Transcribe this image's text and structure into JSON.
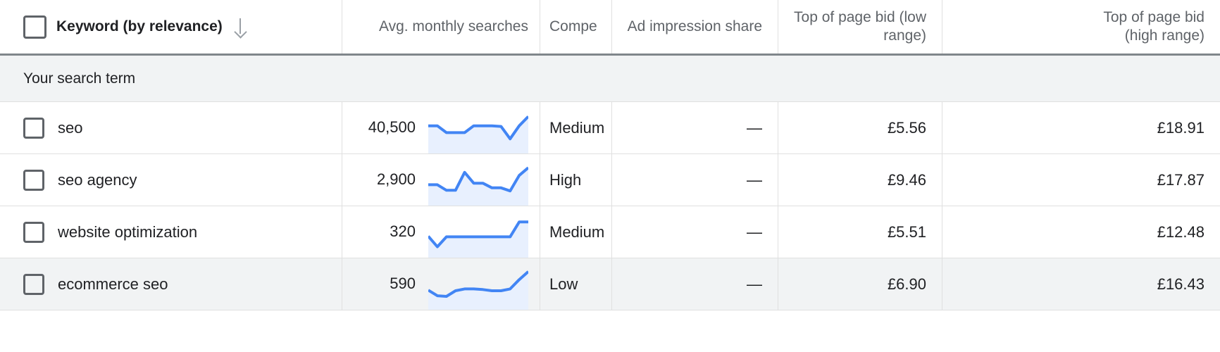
{
  "table": {
    "columns": [
      {
        "id": "keyword",
        "label": "Keyword (by relevance)",
        "sort_icon": "arrow-down-icon"
      },
      {
        "id": "searches",
        "label": "Avg. monthly searches"
      },
      {
        "id": "competition",
        "label": "Compe",
        "full_label": "Competition",
        "truncated": true
      },
      {
        "id": "impression_share",
        "label": "Ad impression share"
      },
      {
        "id": "bid_low",
        "label_line1": "Top of page bid (low",
        "label_line2": "range)"
      },
      {
        "id": "bid_high",
        "label_line1": "Top of page bid",
        "label_line2": "(high range)"
      }
    ],
    "group_label": "Your search term",
    "rows": [
      {
        "keyword": "seo",
        "avg_monthly_searches": "40,500",
        "competition": "Medium",
        "ad_impression_share": "—",
        "bid_low": "£5.56",
        "bid_high": "£18.91",
        "highlighted": false,
        "sparkline": [
          62,
          62,
          40,
          40,
          40,
          62,
          62,
          62,
          60,
          20,
          62,
          92
        ]
      },
      {
        "keyword": "seo agency",
        "avg_monthly_searches": "2,900",
        "competition": "High",
        "ad_impression_share": "—",
        "bid_low": "£9.46",
        "bid_high": "£17.87",
        "highlighted": false,
        "sparkline": [
          40,
          40,
          22,
          22,
          80,
          45,
          45,
          30,
          30,
          20,
          70,
          95
        ]
      },
      {
        "keyword": "website optimization",
        "avg_monthly_searches": "320",
        "competition": "Medium",
        "ad_impression_share": "—",
        "bid_low": "£5.51",
        "bid_high": "£12.48",
        "highlighted": false,
        "sparkline": [
          42,
          8,
          40,
          40,
          40,
          40,
          40,
          40,
          40,
          40,
          88,
          88
        ]
      },
      {
        "keyword": "ecommerce seo",
        "avg_monthly_searches": "590",
        "competition": "Low",
        "ad_impression_share": "—",
        "bid_low": "£6.90",
        "bid_high": "£16.43",
        "highlighted": true,
        "sparkline": [
          36,
          18,
          16,
          34,
          40,
          40,
          38,
          34,
          34,
          40,
          70,
          96
        ]
      }
    ]
  },
  "colors": {
    "spark_line": "#4285f4",
    "spark_fill": "#e8f0fe",
    "row_highlight": "#f1f3f4",
    "header_rule": "#80868b",
    "grid": "#e0e0e0",
    "text_primary": "#202124",
    "text_secondary": "#5f6368"
  }
}
